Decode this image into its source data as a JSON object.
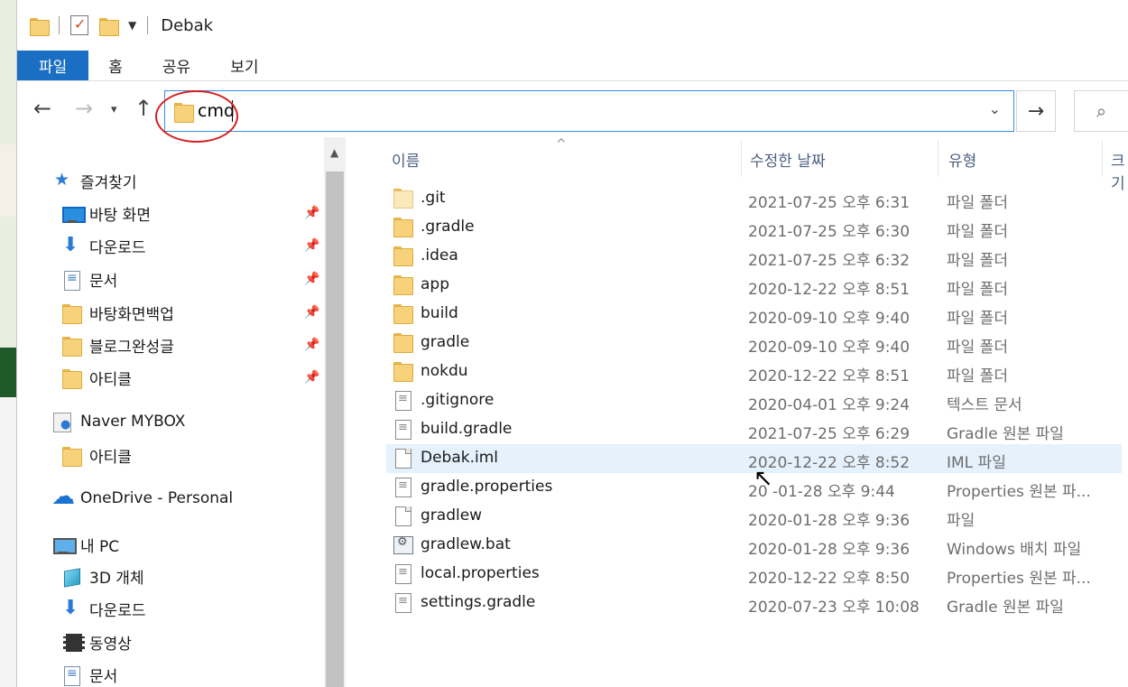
{
  "titlebar": {
    "title": "Debak"
  },
  "ribbon": {
    "tabs": [
      "파일",
      "홈",
      "공유",
      "보기"
    ]
  },
  "address": {
    "value": "cmd"
  },
  "nav": {
    "quick_access": "즐겨찾기",
    "quick_items": [
      "바탕 화면",
      "다운로드",
      "문서",
      "바탕화면백업",
      "블로그완성글",
      "아티클"
    ],
    "mybox": "Naver MYBOX",
    "mybox_items": [
      "아티클"
    ],
    "onedrive": "OneDrive - Personal",
    "pc": "내 PC",
    "pc_items": [
      "3D 개체",
      "다운로드",
      "동영상",
      "문서"
    ]
  },
  "columns": {
    "name": "이름",
    "modified": "수정한 날짜",
    "type": "유형",
    "size": "크기"
  },
  "files": [
    {
      "name": ".git",
      "date": "2021-07-25 오후 6:31",
      "type": "파일 폴더",
      "icon": "folder-light-icon"
    },
    {
      "name": ".gradle",
      "date": "2021-07-25 오후 6:30",
      "type": "파일 폴더",
      "icon": "folder-icon"
    },
    {
      "name": ".idea",
      "date": "2021-07-25 오후 6:32",
      "type": "파일 폴더",
      "icon": "folder-icon"
    },
    {
      "name": "app",
      "date": "2020-12-22 오후 8:51",
      "type": "파일 폴더",
      "icon": "folder-icon"
    },
    {
      "name": "build",
      "date": "2020-09-10 오후 9:40",
      "type": "파일 폴더",
      "icon": "folder-icon"
    },
    {
      "name": "gradle",
      "date": "2020-09-10 오후 9:40",
      "type": "파일 폴더",
      "icon": "folder-icon"
    },
    {
      "name": "nokdu",
      "date": "2020-12-22 오후 8:51",
      "type": "파일 폴더",
      "icon": "folder-icon"
    },
    {
      "name": ".gitignore",
      "date": "2020-04-01 오후 9:24",
      "type": "텍스트 문서",
      "icon": "text-file-icon"
    },
    {
      "name": "build.gradle",
      "date": "2021-07-25 오후 6:29",
      "type": "Gradle 원본 파일",
      "icon": "text-file-icon"
    },
    {
      "name": "Debak.iml",
      "date": "2020-12-22 오후 8:52",
      "type": "IML 파일",
      "icon": "file-icon"
    },
    {
      "name": "gradle.properties",
      "date": "20 -01-28 오후 9:44",
      "type": "Properties 원본 파...",
      "icon": "text-file-icon"
    },
    {
      "name": "gradlew",
      "date": "2020-01-28 오후 9:36",
      "type": "파일",
      "icon": "file-icon"
    },
    {
      "name": "gradlew.bat",
      "date": "2020-01-28 오후 9:36",
      "type": "Windows 배치 파일",
      "icon": "bat-file-icon"
    },
    {
      "name": "local.properties",
      "date": "2020-12-22 오후 8:50",
      "type": "Properties 원본 파...",
      "icon": "text-file-icon"
    },
    {
      "name": "settings.gradle",
      "date": "2020-07-23 오후 10:08",
      "type": "Gradle 원본 파일",
      "icon": "text-file-icon"
    }
  ]
}
